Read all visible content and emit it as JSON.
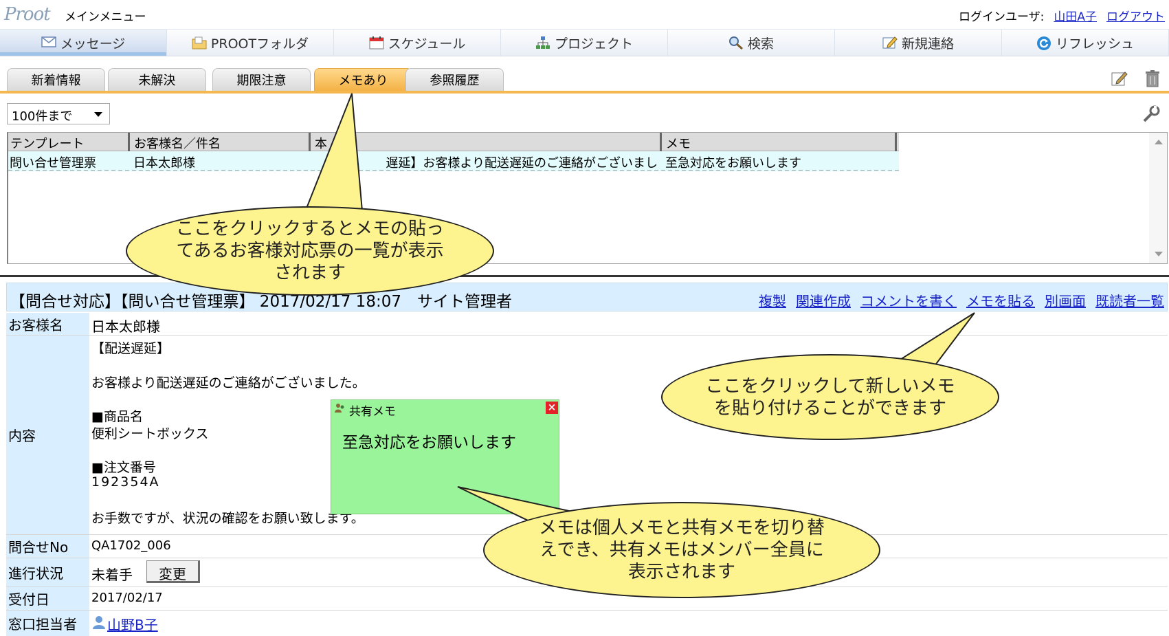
{
  "header": {
    "logo": "Proot",
    "main_menu": "メインメニュー",
    "login_label": "ログインユーザ:",
    "user_name": "山田A子",
    "logout": "ログアウト"
  },
  "menu": [
    {
      "label": "メッセージ",
      "icon": "mail-icon"
    },
    {
      "label": "PROOTフォルダ",
      "icon": "folder-icon"
    },
    {
      "label": "スケジュール",
      "icon": "calendar-icon"
    },
    {
      "label": "プロジェクト",
      "icon": "project-tree-icon"
    },
    {
      "label": "検索",
      "icon": "search-icon"
    },
    {
      "label": "新規連絡",
      "icon": "compose-icon"
    },
    {
      "label": "リフレッシュ",
      "icon": "refresh-icon"
    }
  ],
  "tabs": [
    "新着情報",
    "未解決",
    "期限注意",
    "メモあり",
    "参照履歴"
  ],
  "active_tab": "メモあり",
  "limit_select": "100件まで",
  "list": {
    "headers": [
      "テンプレート",
      "お客様名／件名",
      "本",
      "メモ"
    ],
    "row": {
      "template": "問い合せ管理票",
      "customer": "日本太郎様",
      "body": "遅延】お客様より配送遅延のご連絡がございまし",
      "memo": "至急対応をお願いします"
    }
  },
  "detail": {
    "title": "【問合せ対応】【問い合せ管理票】 2017/02/17 18:07　サイト管理者",
    "links": [
      "複製",
      "関連作成",
      "コメントを書く",
      "メモを貼る",
      "別画面",
      "既読者一覧"
    ],
    "fields": {
      "customer_label": "お客様名",
      "customer_value": "日本太郎様",
      "content_label": "内容",
      "content_lines": [
        "【配送遅延】",
        "お客様より配送遅延のご連絡がございました。",
        "■商品名",
        "便利シートボックス",
        "■注文番号",
        "192354A",
        "お手数ですが、状況の確認をお願い致します。"
      ],
      "inquiry_no_label": "問合せNo",
      "inquiry_no_value": "QA1702_006",
      "status_label": "進行状況",
      "status_value": "未着手",
      "change_button": "変更",
      "received_label": "受付日",
      "received_value": "2017/02/17",
      "contact_label": "窓口担当者",
      "contact_value": "山野B子"
    }
  },
  "memo_popup": {
    "title": "共有メモ",
    "close": "×",
    "body": "至急対応をお願いします",
    "color": "#9af59a"
  },
  "callouts": {
    "c1": "ここをクリックするとメモの貼ってあるお客様対応票の一覧が表示されます",
    "c2": "ここをクリックして新しいメモを貼り付けることができます",
    "c3": "メモは個人メモと共有メモを切り替えでき、共有メモはメンバー全員に表示されます"
  },
  "colors": {
    "accent_tab": "#f5b750",
    "link": "#1a25c8",
    "label_bg": "#d9efff",
    "callout_bg": "#fdf38f"
  }
}
